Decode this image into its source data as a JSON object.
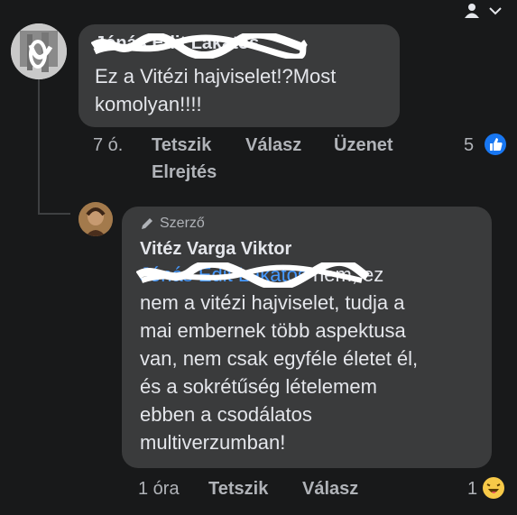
{
  "comment": {
    "author": "Jónás Edit Lakatos",
    "text": "Ez a Vitézi hajviselet!?Most komolyan!!!!",
    "time": "7 ó.",
    "actions": {
      "like": "Tetszik",
      "reply": "Válasz",
      "message": "Üzenet",
      "hide": "Elrejtés"
    },
    "reaction_count": "5",
    "reaction_icon": "like-icon"
  },
  "reply": {
    "badge": "Szerző",
    "author": "Vitéz Varga Viktor",
    "mention": "Jónás Edit Lakatos",
    "text_line1": "nem, ez",
    "text_rest": [
      "nem a vitézi hajviselet, tudja a",
      "mai embernek több aspektusa",
      "van, nem csak egyféle életet él,",
      "és a sokrétűség lételemem",
      "ebben a csodálatos",
      "multiverzumban!"
    ],
    "time": "1 óra",
    "actions": {
      "like": "Tetszik",
      "reply": "Válasz"
    },
    "reaction_count": "1",
    "reaction_icon": "haha-emoji-icon"
  },
  "colors": {
    "background": "#18191a",
    "bubble": "#3a3b3c",
    "muted": "#b0b3b8",
    "link": "#4599ff",
    "like": "#1877f2"
  }
}
